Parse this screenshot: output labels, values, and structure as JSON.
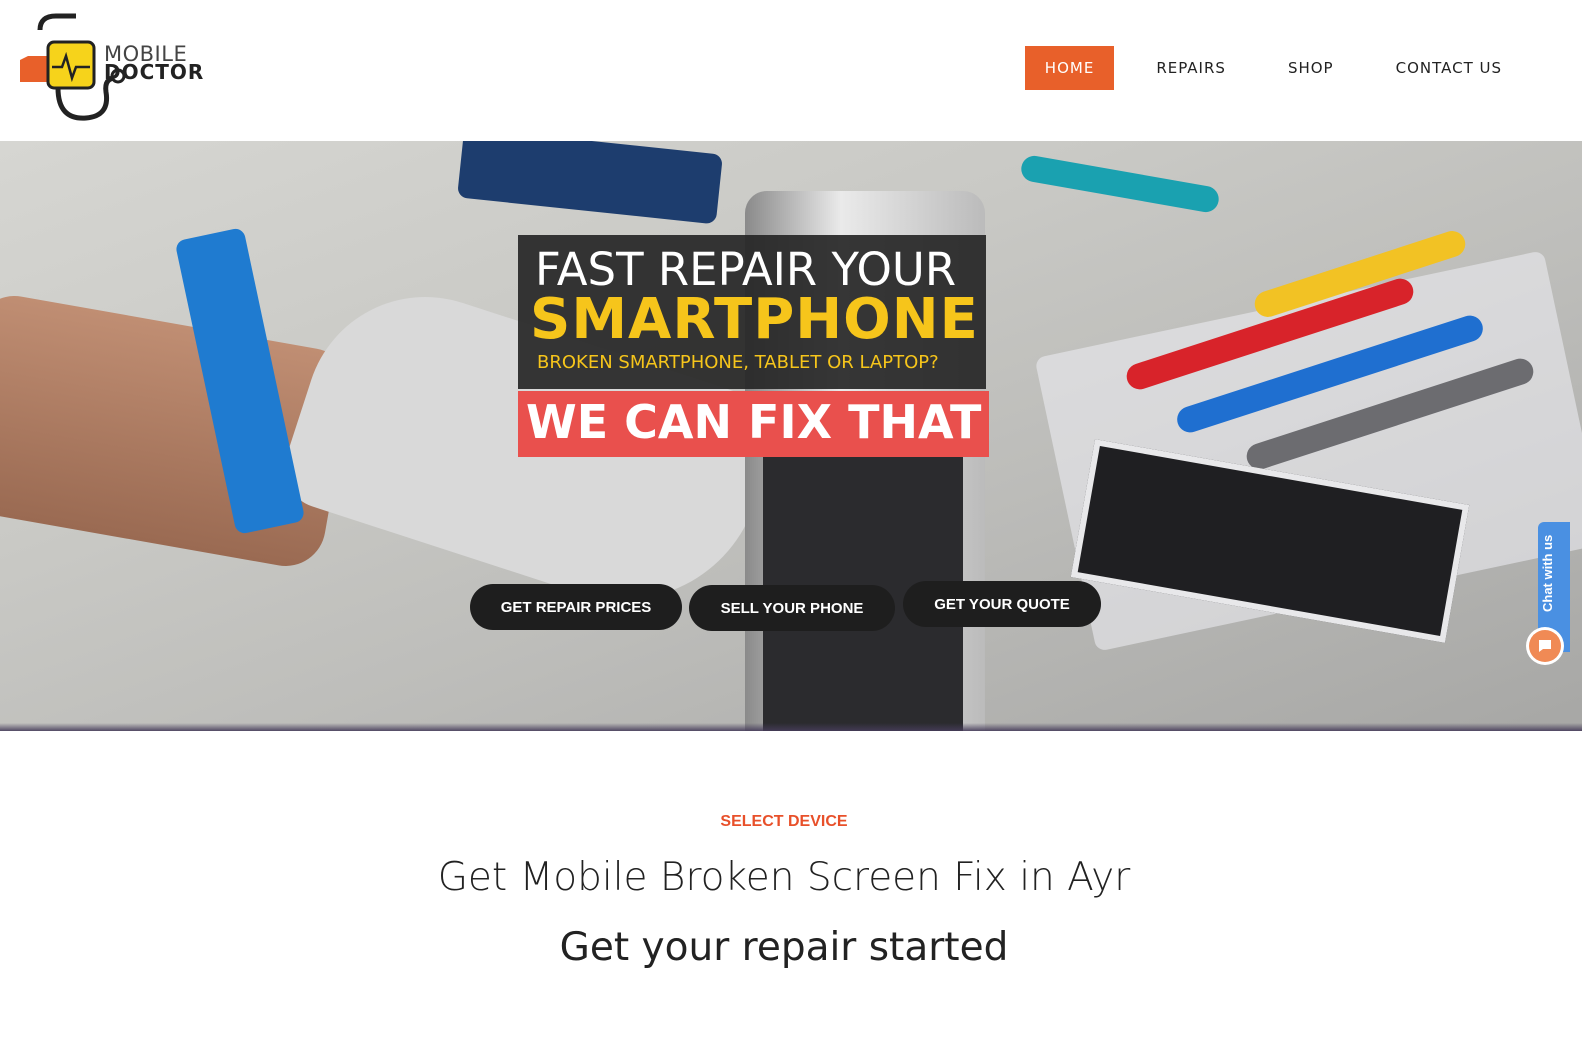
{
  "brand": {
    "line1": "MOBILE",
    "line2": "DOCTOR"
  },
  "nav": {
    "items": [
      {
        "label": "HOME",
        "active": true
      },
      {
        "label": "REPAIRS",
        "active": false
      },
      {
        "label": "SHOP",
        "active": false
      },
      {
        "label": "CONTACT US",
        "active": false
      }
    ]
  },
  "hero": {
    "headline_1": "FAST REPAIR YOUR",
    "headline_2": "SMARTPHONE",
    "headline_3": "BROKEN SMARTPHONE, TABLET OR LAPTOP?",
    "fix_text": "WE CAN FIX THAT",
    "buttons": {
      "repair_prices": "GET REPAIR PRICES",
      "sell_phone": "SELL YOUR PHONE",
      "quote": "GET YOUR QUOTE"
    }
  },
  "chat": {
    "label": "Chat with us"
  },
  "section": {
    "eyebrow": "SELECT DEVICE",
    "title": "Get Mobile Broken Screen Fix in Ayr",
    "subtitle": "Get your repair started"
  },
  "colors": {
    "accent": "#e8602a",
    "headline_yellow": "#f6c51b",
    "fix_red": "#e9504d",
    "chat_blue": "#4a90e2"
  }
}
